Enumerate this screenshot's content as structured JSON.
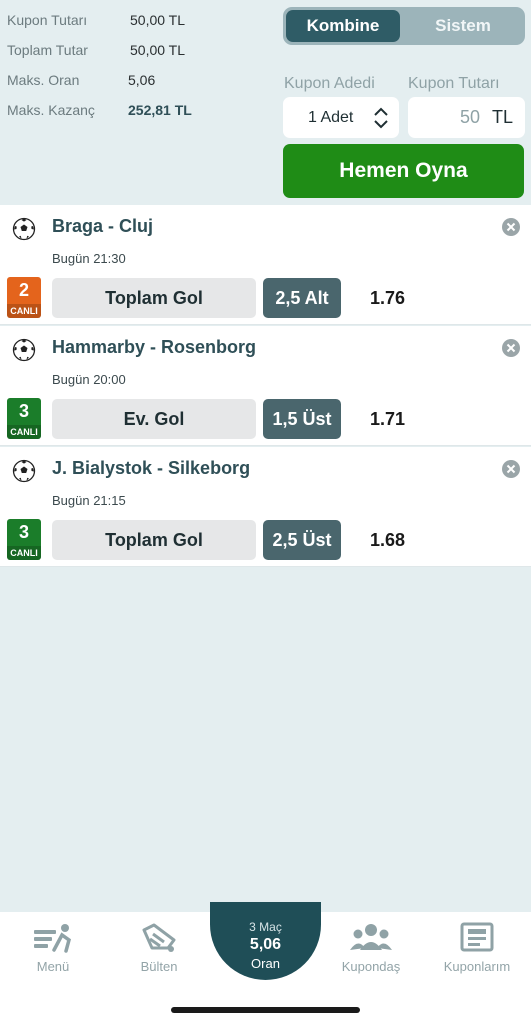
{
  "summary": {
    "kupon_tutari_label": "Kupon Tutarı",
    "kupon_tutari_value": "50,00 TL",
    "toplam_tutar_label": "Toplam Tutar",
    "toplam_tutar_value": "50,00 TL",
    "maks_oran_label": "Maks. Oran",
    "maks_oran_value": "5,06",
    "maks_kazanc_label": "Maks. Kazanç",
    "maks_kazanc_value": "252,81 TL"
  },
  "segment": {
    "active": "Kombine",
    "inactive": "Sistem"
  },
  "kupon_adedi": {
    "label": "Kupon Adedi",
    "value": "1 Adet"
  },
  "kupon_tutari": {
    "label": "Kupon Tutarı",
    "value": "50",
    "unit": "TL"
  },
  "play_button": "Hemen Oyna",
  "matches": [
    {
      "title": "Braga - Cluj",
      "time": "Bugün 21:30",
      "badge_num": "2",
      "badge_text": "CANLI",
      "badge_color": "#e4641c",
      "market": "Toplam Gol",
      "selection": "2,5 Alt",
      "odds": "1.76"
    },
    {
      "title": "Hammarby - Rosenborg",
      "time": "Bugün 20:00",
      "badge_num": "3",
      "badge_text": "CANLI",
      "badge_color": "#1b7d2a",
      "market": "Ev. Gol",
      "selection": "1,5 Üst",
      "odds": "1.71"
    },
    {
      "title": "J. Bialystok - Silkeborg",
      "time": "Bugün 21:15",
      "badge_num": "3",
      "badge_text": "CANLI",
      "badge_color": "#1b7d2a",
      "market": "Toplam Gol",
      "selection": "2,5 Üst",
      "odds": "1.68"
    }
  ],
  "nav": {
    "menu": "Menü",
    "bulten": "Bülten",
    "center_count": "3 Maç",
    "center_odds": "5,06",
    "center_label": "Oran",
    "kupondas": "Kupondaş",
    "kuponlarim": "Kuponlarım"
  },
  "icons": {
    "ball": "soccer-ball-icon",
    "remove": "close-circle-icon",
    "stepper": "chevron-up-down-icon",
    "menu": "menu-runner-icon",
    "bulten": "bulletin-icon",
    "kupondas": "group-icon",
    "kuponlarim": "coupons-icon"
  }
}
